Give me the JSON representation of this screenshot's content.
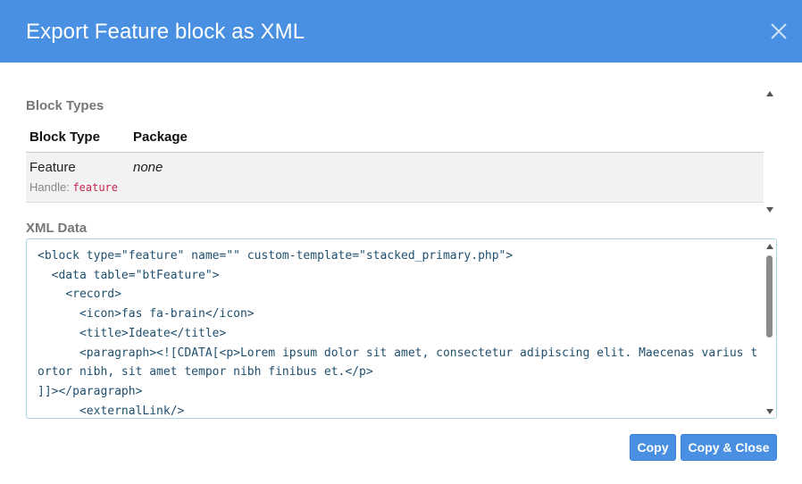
{
  "dialog": {
    "title": "Export Feature block as XML"
  },
  "block_types": {
    "label": "Block Types",
    "columns": [
      "Block Type",
      "Package"
    ],
    "rows": [
      {
        "block_type": "Feature",
        "package": "none",
        "handle_label": "Handle:",
        "handle": "feature"
      }
    ]
  },
  "xml_data": {
    "label": "XML Data",
    "lines": [
      "<block type=\"feature\" name=\"\" custom-template=\"stacked_primary.php\">",
      "  <data table=\"btFeature\">",
      "    <record>",
      "      <icon>fas fa-brain</icon>",
      "      <title>Ideate</title>",
      "      <paragraph><![CDATA[<p>Lorem ipsum dolor sit amet, consectetur adipiscing elit. Maecenas varius tortor nibh, sit amet tempor nibh finibus et.</p>",
      "]]></paragraph>",
      "      <externalLink/>"
    ]
  },
  "buttons": {
    "copy": "Copy",
    "copy_close": "Copy & Close"
  },
  "colors": {
    "header": "#4a90e2",
    "button": "#4a90e2",
    "handle_code": "#c7254e"
  }
}
